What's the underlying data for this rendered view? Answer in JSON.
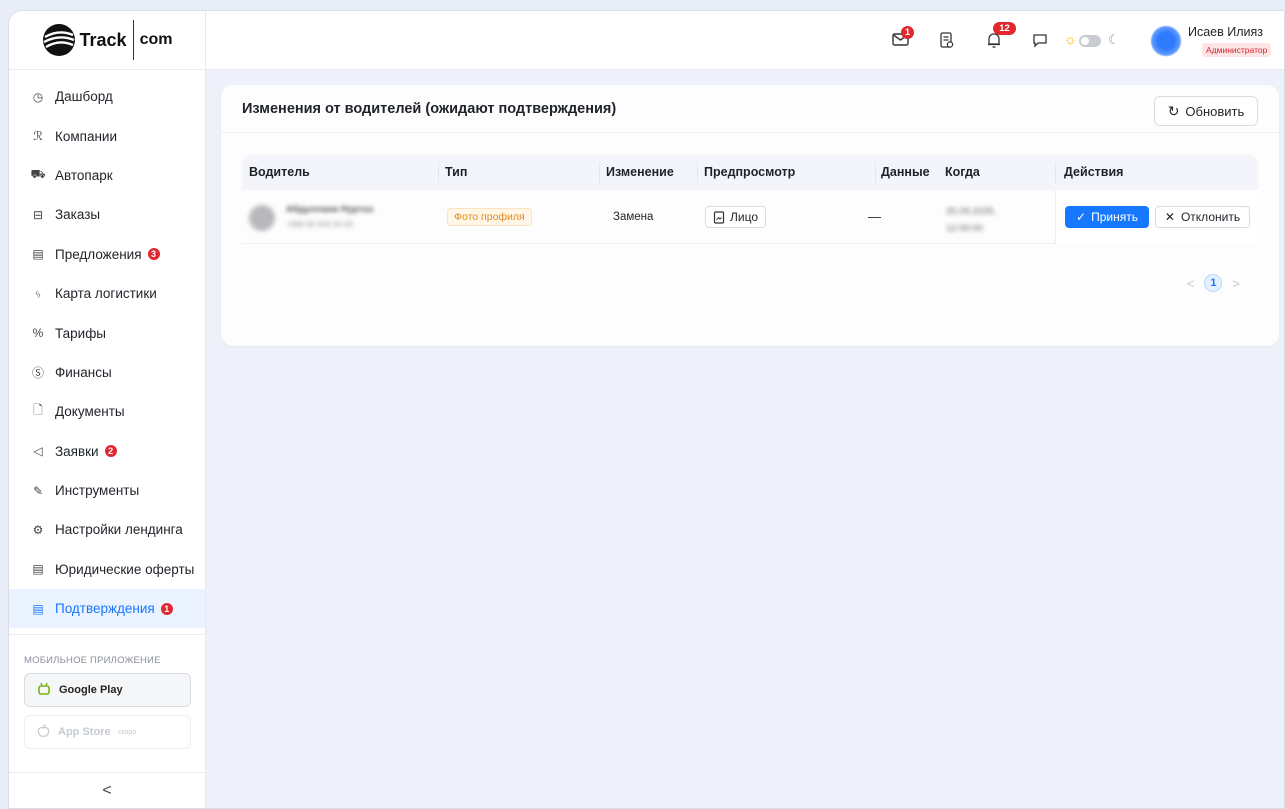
{
  "brand": {
    "name": "Track",
    "suffix": "com"
  },
  "sidebar": {
    "items": [
      {
        "label": "Дашборд",
        "icon": "dashboard-icon",
        "glyph": "◷"
      },
      {
        "label": "Компании",
        "icon": "users-icon",
        "glyph": "ℛ"
      },
      {
        "label": "Автопарк",
        "icon": "car-icon",
        "glyph": "⛟"
      },
      {
        "label": "Заказы",
        "icon": "box-icon",
        "glyph": "⊟"
      },
      {
        "label": "Предложения",
        "icon": "offers-icon",
        "glyph": "▤",
        "badge": "3"
      },
      {
        "label": "Карта логистики",
        "icon": "route-icon",
        "glyph": "ᛃ"
      },
      {
        "label": "Тарифы",
        "icon": "percent-icon",
        "glyph": "%"
      },
      {
        "label": "Финансы",
        "icon": "dollar-icon",
        "glyph": "Ⓢ"
      },
      {
        "label": "Документы",
        "icon": "file-icon",
        "glyph": "🗋"
      },
      {
        "label": "Заявки",
        "icon": "megaphone-icon",
        "glyph": "◁",
        "badge": "2"
      },
      {
        "label": "Инструменты",
        "icon": "wrench-icon",
        "glyph": "✎"
      },
      {
        "label": "Настройки лендинга",
        "icon": "settings-icon",
        "glyph": "⚙"
      },
      {
        "label": "Юридические оферты",
        "icon": "legal-icon",
        "glyph": "▤"
      },
      {
        "label": "Подтверждения",
        "icon": "confirm-icon",
        "glyph": "▤",
        "badge": "1",
        "active": true
      }
    ],
    "mobile_label": "МОБИЛЬНОЕ ПРИЛОЖЕНИЕ",
    "google_play": "Google Play",
    "app_store": "App Store",
    "app_store_soon": "· скоро",
    "collapse_glyph": "<"
  },
  "topbar": {
    "mail_badge": "1",
    "notif_badge": "12",
    "user_name": "Исаев Илияз",
    "user_role": "Администратор"
  },
  "card": {
    "title": "Изменения от водителей (ожидают подтверждения)",
    "refresh_label": "Обновить"
  },
  "table": {
    "columns": [
      "Водитель",
      "Тип",
      "Изменение",
      "Предпросмотр",
      "Данные",
      "Когда",
      "Действия"
    ],
    "rows": [
      {
        "driver_name": "Абдуллаев Нуртаз",
        "driver_sub": "+998 90 000 00 00",
        "type": "Фото профиля",
        "change": "Замена",
        "preview": "Лицо",
        "data": "—",
        "when_date": "25.09.2025,",
        "when_time": "12:00:00",
        "accept": "Принять",
        "reject": "Отклонить"
      }
    ]
  },
  "pagination": {
    "current": "1",
    "prev": "<",
    "next": ">"
  },
  "colors": {
    "accent": "#1677ff",
    "badge": "#e0282e",
    "tag": "#e08a1a"
  }
}
